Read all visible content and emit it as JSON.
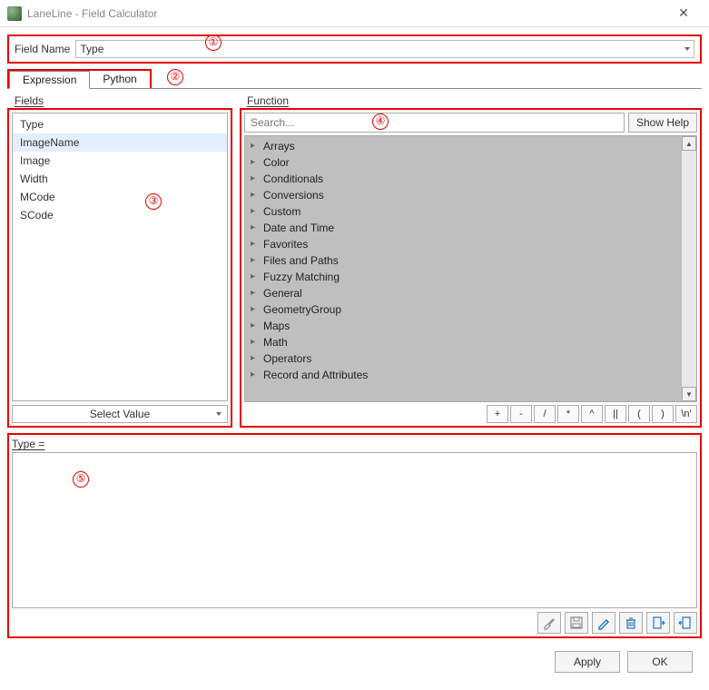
{
  "window": {
    "title": "LaneLine - Field Calculator"
  },
  "fieldName": {
    "label": "Field Name",
    "value": "Type"
  },
  "tabs": {
    "items": [
      {
        "label": "Expression",
        "active": true
      },
      {
        "label": "Python",
        "active": false
      }
    ]
  },
  "fieldsPanel": {
    "title": "Fields",
    "items": [
      "Type",
      "ImageName",
      "Image",
      "Width",
      "MCode",
      "SCode"
    ],
    "selectedIndex": 1,
    "selectValueLabel": "Select Value"
  },
  "functionPanel": {
    "title": "Function",
    "searchPlaceholder": "Search...",
    "showHelpLabel": "Show Help",
    "categories": [
      "Arrays",
      "Color",
      "Conditionals",
      "Conversions",
      "Custom",
      "Date and Time",
      "Favorites",
      "Files and Paths",
      "Fuzzy Matching",
      "General",
      "GeometryGroup",
      "Maps",
      "Math",
      "Operators",
      "Record and Attributes"
    ],
    "operators": [
      "+",
      "-",
      "/",
      "*",
      "^",
      "||",
      "(",
      ")",
      "\\n'"
    ]
  },
  "expression": {
    "label": "Type ="
  },
  "buttons": {
    "apply": "Apply",
    "ok": "OK"
  },
  "callouts": [
    "①",
    "②",
    "③",
    "④",
    "⑤"
  ]
}
